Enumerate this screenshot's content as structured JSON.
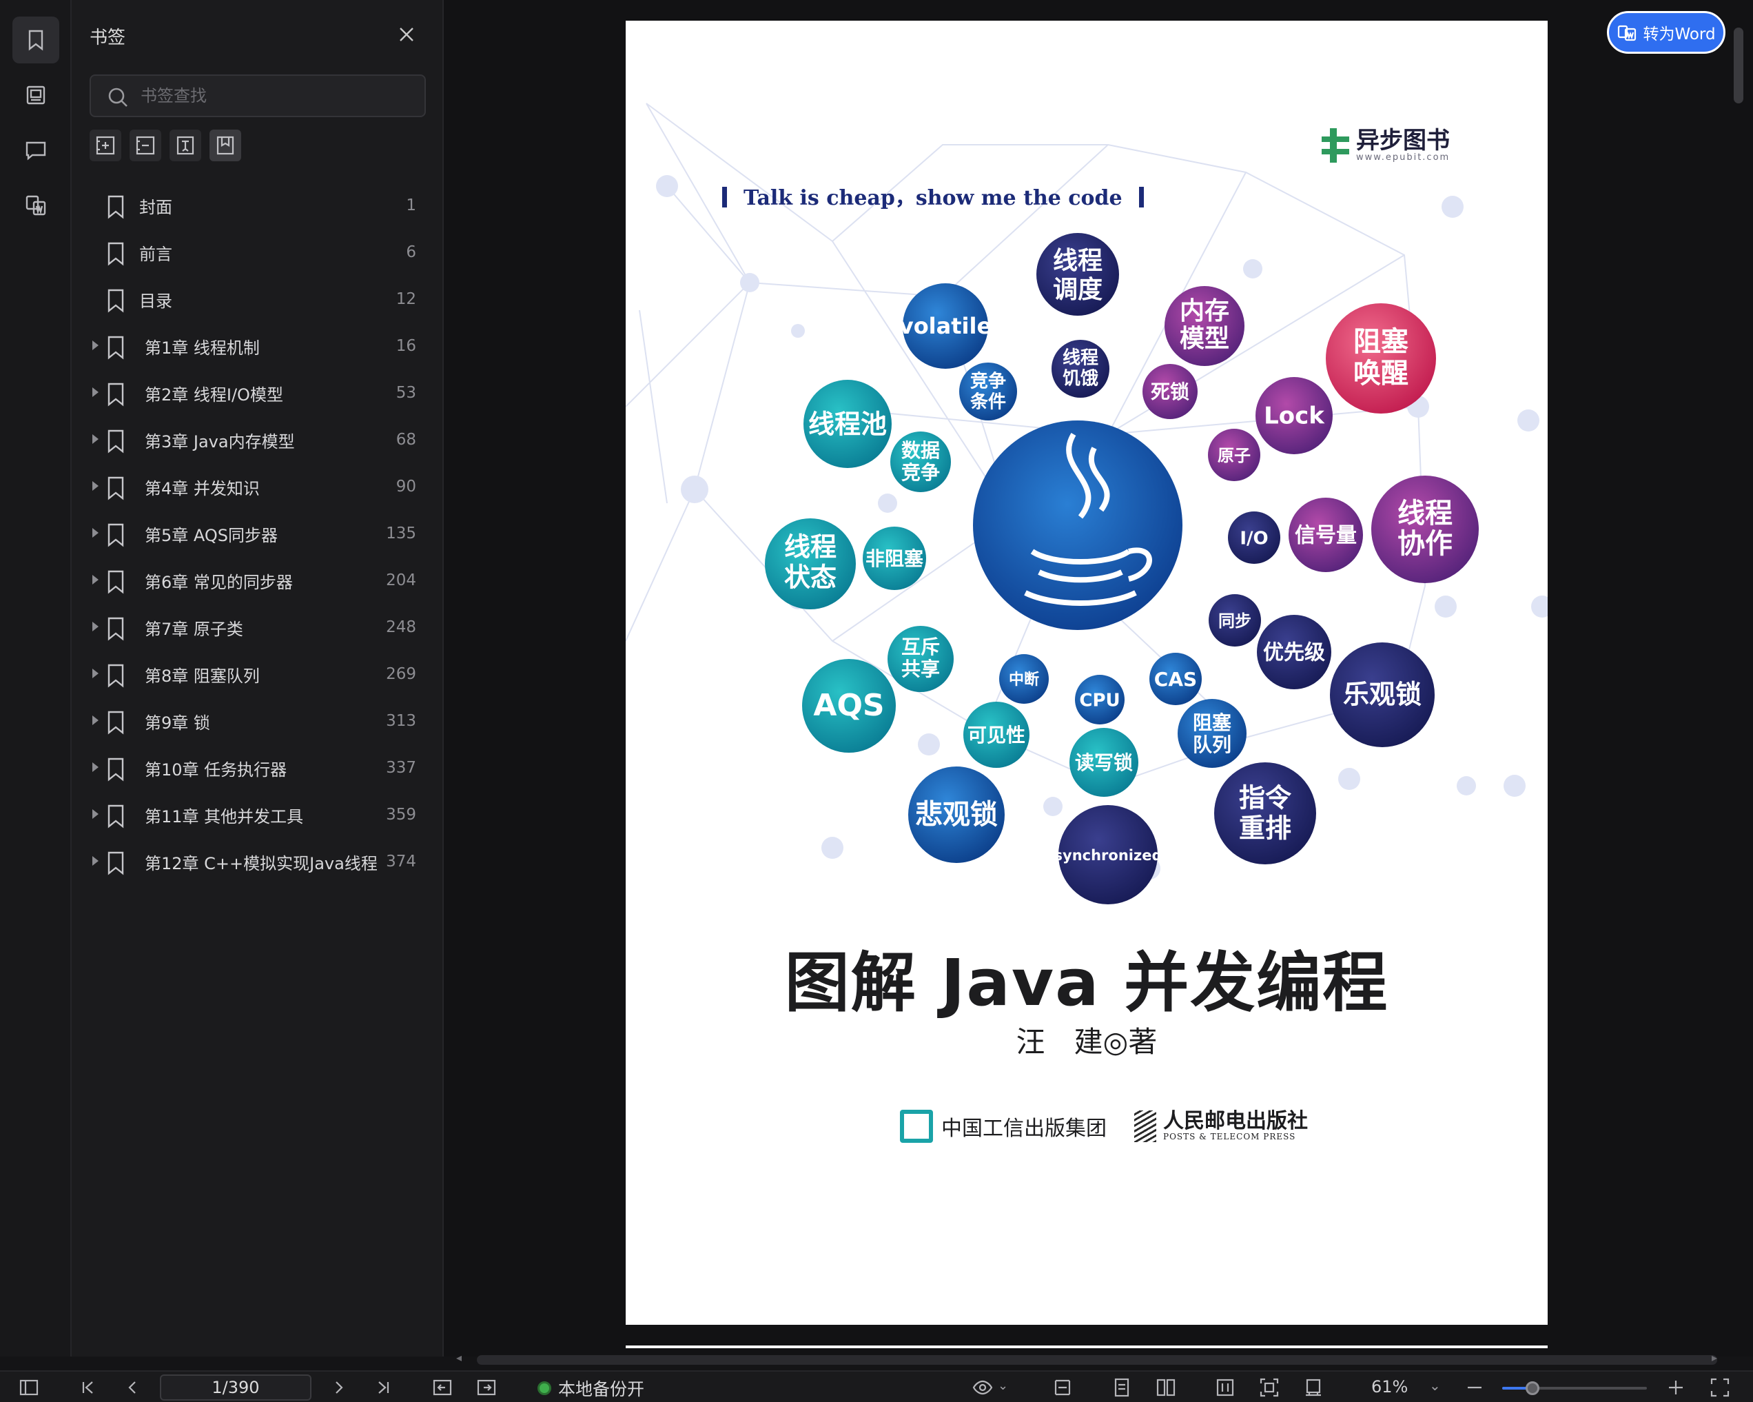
{
  "panel": {
    "title": "书签",
    "search_placeholder": "书签查找"
  },
  "bookmarks": [
    {
      "label": "封面",
      "page": "1",
      "expandable": false
    },
    {
      "label": "前言",
      "page": "6",
      "expandable": false
    },
    {
      "label": "目录",
      "page": "12",
      "expandable": false
    },
    {
      "label": "第1章 线程机制",
      "page": "16",
      "expandable": true
    },
    {
      "label": "第2章 线程I/O模型",
      "page": "53",
      "expandable": true
    },
    {
      "label": "第3章 Java内存模型",
      "page": "68",
      "expandable": true
    },
    {
      "label": "第4章 并发知识",
      "page": "90",
      "expandable": true
    },
    {
      "label": "第5章 AQS同步器",
      "page": "135",
      "expandable": true
    },
    {
      "label": "第6章 常见的同步器",
      "page": "204",
      "expandable": true
    },
    {
      "label": "第7章 原子类",
      "page": "248",
      "expandable": true
    },
    {
      "label": "第8章 阻塞队列",
      "page": "269",
      "expandable": true
    },
    {
      "label": "第9章 锁",
      "page": "313",
      "expandable": true
    },
    {
      "label": "第10章 任务执行器",
      "page": "337",
      "expandable": true
    },
    {
      "label": "第11章 其他并发工具",
      "page": "359",
      "expandable": true
    },
    {
      "label": "第12章 C++模拟实现Java线程",
      "page": "374",
      "expandable": true
    }
  ],
  "toolbar": {
    "convert_label": "转为Word"
  },
  "cover": {
    "tagline": "Talk is cheap，show me the code",
    "publisher_top_name": "异步图书",
    "publisher_top_url": "www.epubit.com",
    "title": "图解 Java 并发编程",
    "author": "汪　建◎著",
    "publisher_a": "中国工信出版集团",
    "publisher_b": "人民邮电出版社",
    "publisher_b_en": "POSTS & TELECOM PRESS",
    "bubbles": [
      "线程调度",
      "内存模型",
      "阻塞唤醒",
      "volatile",
      "线程饥饿",
      "死锁",
      "Lock",
      "竞争条件",
      "线程池",
      "原子",
      "数据竞争",
      "线程协作",
      "I/O",
      "信号量",
      "线程状态",
      "非阻塞",
      "同步",
      "优先级",
      "互斥共享",
      "中断",
      "CAS",
      "乐观锁",
      "AQS",
      "CPU",
      "可见性",
      "阻塞队列",
      "读写锁",
      "指令重排",
      "悲观锁",
      "synchronized"
    ]
  },
  "statusbar": {
    "page_value": "1/390",
    "backup_label": "本地备份开",
    "zoom_label": "61%",
    "zoom_fraction": 0.21
  },
  "colors": {
    "accent": "#2f6ef0",
    "backup_dot": "#3fae4c"
  }
}
